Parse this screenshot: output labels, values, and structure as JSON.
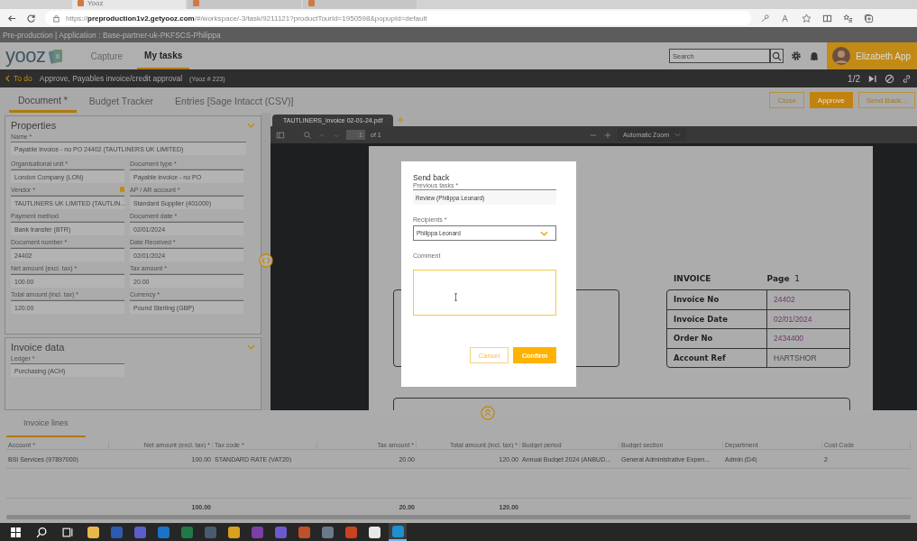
{
  "browser": {
    "tabs": [
      {
        "title": "Yooz",
        "selected": true
      },
      {
        "selected": false
      },
      {
        "selected": false
      }
    ],
    "url": "https://**preproduction1v2.getyooz.com**/#/workspace/-3/task/9211121?productTourId=1950598&popupId=default"
  },
  "env_bar": "Pre-production | Application : Base-partner-uk-PKFSCS-Philippa",
  "app": {
    "logo": "yooz",
    "nav": [
      {
        "label": "Capture",
        "selected": false
      },
      {
        "label": "My tasks",
        "selected": true
      }
    ],
    "search": {
      "placeholder": "Search"
    },
    "user": "Elizabeth App"
  },
  "task_bar": {
    "back": "To do",
    "title": "Approve, Payables invoice/credit approval",
    "ref": "(Yooz # 223)",
    "pager": "1/2"
  },
  "doc_tabs": [
    {
      "label": "Document *",
      "selected": true
    },
    {
      "label": "Budget Tracker",
      "selected": false
    },
    {
      "label": "Entries [Sage Intacct (CSV)]",
      "selected": false
    }
  ],
  "actions": [
    {
      "label": "Close",
      "kind": "outline"
    },
    {
      "label": "Approve",
      "kind": "primary"
    },
    {
      "label": "Send Back...",
      "kind": "outline"
    }
  ],
  "properties": {
    "title": "Properties",
    "name": {
      "label": "Name *",
      "value": "Payable invoice - no PO 24402 (TAUTLINERS UK LIMITED)"
    },
    "fields": [
      {
        "label": "Organisational unit *",
        "value": "London Company (LON)",
        "flagged": false
      },
      {
        "label": "Document type *",
        "value": "Payable invoice - no PO",
        "flagged": false
      },
      {
        "label": "Vendor *",
        "value": "TAUTLINERS UK LIMITED (TAUTLIN...",
        "flagged": true
      },
      {
        "label": "AP / AR account *",
        "value": "Standard Supplier (401000)",
        "flagged": false
      },
      {
        "label": "Payment method",
        "value": "Bank transfer (BTR)",
        "flagged": false
      },
      {
        "label": "Document date *",
        "value": "02/01/2024",
        "flagged": false
      },
      {
        "label": "Document number *",
        "value": "24402",
        "flagged": false
      },
      {
        "label": "Date Received *",
        "value": "02/01/2024",
        "flagged": false
      },
      {
        "label": "Net amount (excl. tax) *",
        "value": "100.00",
        "flagged": false
      },
      {
        "label": "Tax amount *",
        "value": "20.00",
        "flagged": false
      },
      {
        "label": "Total amount (incl. tax) *",
        "value": "120.00",
        "flagged": false
      },
      {
        "label": "Currency *",
        "value": "Pound Sterling (GBP)",
        "flagged": false
      }
    ]
  },
  "invoice_data": {
    "title": "Invoice data",
    "fields": [
      {
        "label": "Ledger *",
        "value": "Purchasing (ACH)"
      }
    ]
  },
  "viewer": {
    "file_tab": "TAUTLINERS_invoice 02-01-24.pdf",
    "page": "1",
    "page_count": "of 1",
    "zoom": "Automatic Zoom",
    "invoice": {
      "heading": "INVOICE",
      "page_label": "Page",
      "page_no": "1",
      "rows": [
        {
          "label": "Invoice No",
          "value": "24402",
          "highlighted": true
        },
        {
          "label": "Invoice Date",
          "value": "02/01/2024",
          "highlighted": true
        },
        {
          "label": "Order No",
          "value": "2434400",
          "highlighted": true
        },
        {
          "label": "Account Ref",
          "value": "HARTSHOR",
          "highlighted": false
        }
      ]
    }
  },
  "dialog": {
    "title": "Send back",
    "previous_label": "Previous tasks *",
    "previous_value": "Review (Philippa Leonard)",
    "recipients_label": "Recipients *",
    "recipients_value": "Philippa Leonard",
    "comment_label": "Comment",
    "buttons": [
      {
        "label": "Cancel",
        "kind": "secondary"
      },
      {
        "label": "Confirm",
        "kind": "primary"
      }
    ]
  },
  "invoice_lines": {
    "tab": "Invoice lines",
    "columns": [
      {
        "label": "Account *",
        "kind": "text"
      },
      {
        "label": "Net amount (excl. tax) *",
        "kind": "amount",
        "total": "100.00"
      },
      {
        "label": "Tax code *",
        "kind": "text"
      },
      {
        "label": "Tax amount *",
        "kind": "amount",
        "total": "20.00"
      },
      {
        "label": "Total amount (incl. tax) *",
        "kind": "amount",
        "total": "120.00"
      },
      {
        "label": "Budget period",
        "kind": "text"
      },
      {
        "label": "Budget section",
        "kind": "text"
      },
      {
        "label": "Department",
        "kind": "text"
      },
      {
        "label": "Cost Code",
        "kind": "text"
      }
    ],
    "rows": [
      [
        "BSI Services (97897000)",
        "100.00",
        "STANDARD RATE (VAT20)",
        "20.00",
        "120.00",
        "Annual Budget 2024 (ANBUD...",
        "General Administrative Expen...",
        "Admin (D4)",
        "2"
      ]
    ]
  },
  "taskbar": {
    "apps": [
      {
        "kind": "folder",
        "active": false
      },
      {
        "kind": "word",
        "active": false
      },
      {
        "kind": "teams",
        "active": false
      },
      {
        "kind": "outlook",
        "active": false
      },
      {
        "kind": "excel",
        "active": false
      },
      {
        "kind": "calculator",
        "active": false
      },
      {
        "kind": "chrome",
        "active": false
      },
      {
        "kind": "onenote",
        "active": false
      },
      {
        "kind": "chat",
        "active": false
      },
      {
        "kind": "tool",
        "active": false
      },
      {
        "kind": "camera",
        "active": false
      },
      {
        "kind": "powerpoint",
        "active": false
      },
      {
        "kind": "g",
        "active": false
      },
      {
        "kind": "edge",
        "active": true
      }
    ]
  }
}
